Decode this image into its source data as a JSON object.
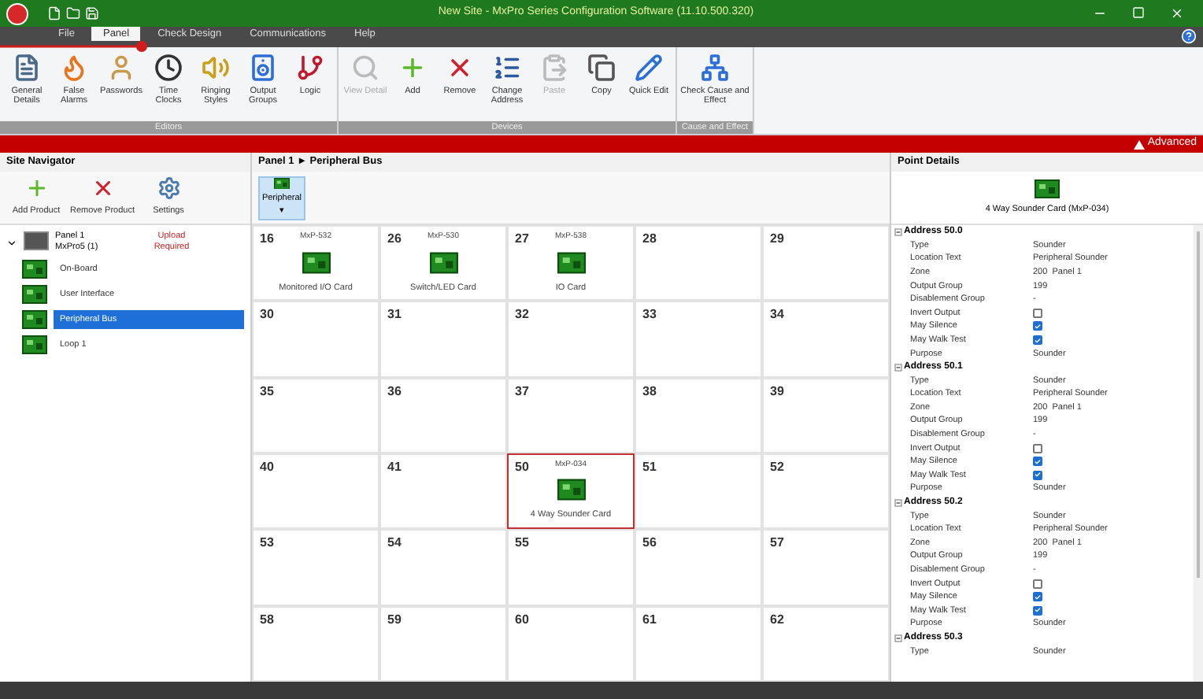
{
  "window": {
    "title": "New Site - MxPro Series Configuration Software (11.10.500.320)"
  },
  "menu_tabs": [
    {
      "label": "File",
      "selected": false
    },
    {
      "label": "Panel",
      "selected": true
    },
    {
      "label": "Check Design",
      "selected": false
    },
    {
      "label": "Communications",
      "selected": false
    },
    {
      "label": "Help",
      "selected": false
    }
  ],
  "ribbon_groups": [
    {
      "title": "Editors",
      "buttons": [
        {
          "label": "General Details",
          "kind": "details",
          "disabled": false
        },
        {
          "label": "False Alarms",
          "kind": "alarm",
          "disabled": false
        },
        {
          "label": "Passwords",
          "kind": "user",
          "disabled": false
        },
        {
          "label": "Time Clocks",
          "kind": "clock",
          "disabled": false
        },
        {
          "label": "Ringing Styles",
          "kind": "speaker",
          "disabled": false
        },
        {
          "label": "Output Groups",
          "kind": "groups",
          "disabled": false
        },
        {
          "label": "Logic",
          "kind": "logic",
          "disabled": false
        }
      ]
    },
    {
      "title": "Devices",
      "buttons": [
        {
          "label": "View Detail",
          "kind": "view",
          "disabled": true
        },
        {
          "label": "Add",
          "kind": "add",
          "disabled": false
        },
        {
          "label": "Remove",
          "kind": "remove",
          "disabled": false
        },
        {
          "label": "Change Address",
          "kind": "address",
          "disabled": false
        },
        {
          "label": "Paste",
          "kind": "paste",
          "disabled": true
        },
        {
          "label": "Copy",
          "kind": "copy",
          "disabled": false
        },
        {
          "label": "Quick Edit",
          "kind": "edit",
          "disabled": false
        }
      ]
    },
    {
      "title": "Cause and Effect",
      "buttons": [
        {
          "label": "Check Cause and Effect",
          "kind": "cause",
          "disabled": false
        }
      ]
    }
  ],
  "brand": "Advanced",
  "site_navigator": {
    "title": "Site Navigator",
    "tools": [
      {
        "label": "Add Product",
        "kind": "add"
      },
      {
        "label": "Remove Product",
        "kind": "remove"
      },
      {
        "label": "Settings",
        "kind": "settings"
      }
    ],
    "tree": [
      {
        "label": "Panel 1",
        "sublabel": "MxPro5 (1)",
        "status": "Upload Required",
        "expanded": true,
        "children": [
          {
            "label": "On-Board",
            "selected": false
          },
          {
            "label": "User Interface",
            "selected": false
          },
          {
            "label": "Peripheral Bus",
            "selected": true
          },
          {
            "label": "Loop 1",
            "selected": false
          }
        ]
      }
    ]
  },
  "peripheral_bus": {
    "breadcrumb": "Panel 1 ► Peripheral Bus",
    "tool": "Peripheral ▾",
    "cells": [
      {
        "address": "16",
        "model": "MxP-532",
        "name": "Monitored I/O Card",
        "selected": false
      },
      {
        "address": "26",
        "model": "MxP-530",
        "name": "Switch/LED Card",
        "selected": false
      },
      {
        "address": "27",
        "model": "MxP-538",
        "name": "IO Card",
        "selected": false
      },
      {
        "address": "28"
      },
      {
        "address": "29"
      },
      {
        "address": "30"
      },
      {
        "address": "31"
      },
      {
        "address": "32"
      },
      {
        "address": "33"
      },
      {
        "address": "34"
      },
      {
        "address": "35"
      },
      {
        "address": "36"
      },
      {
        "address": "37"
      },
      {
        "address": "38"
      },
      {
        "address": "39"
      },
      {
        "address": "40"
      },
      {
        "address": "41"
      },
      {
        "address": "50",
        "model": "MxP-034",
        "name": "4 Way Sounder Card",
        "selected": true
      },
      {
        "address": "51"
      },
      {
        "address": "52"
      },
      {
        "address": "53"
      },
      {
        "address": "54"
      },
      {
        "address": "55"
      },
      {
        "address": "56"
      },
      {
        "address": "57"
      },
      {
        "address": "58"
      },
      {
        "address": "59"
      },
      {
        "address": "60"
      },
      {
        "address": "61"
      },
      {
        "address": "62"
      }
    ]
  },
  "point_details": {
    "title": "Point Details",
    "device": "4 Way Sounder Card (MxP-034)",
    "groups": [
      {
        "title": "Address 50.0",
        "properties": [
          {
            "name": "Type",
            "value": "Sounder"
          },
          {
            "name": "Location Text",
            "value": "Peripheral Sounder"
          },
          {
            "name": "Zone",
            "value": "200  Panel 1"
          },
          {
            "name": "Output Group",
            "value": "199"
          },
          {
            "name": "Disablement Group",
            "value": "-"
          },
          {
            "name": "Invert Output",
            "kind": "check",
            "checked": false
          },
          {
            "name": "May Silence",
            "kind": "check",
            "checked": true
          },
          {
            "name": "May Walk Test",
            "kind": "check",
            "checked": true
          },
          {
            "name": "Purpose",
            "value": "Sounder"
          }
        ]
      },
      {
        "title": "Address 50.1",
        "properties": [
          {
            "name": "Type",
            "value": "Sounder"
          },
          {
            "name": "Location Text",
            "value": "Peripheral Sounder"
          },
          {
            "name": "Zone",
            "value": "200  Panel 1"
          },
          {
            "name": "Output Group",
            "value": "199"
          },
          {
            "name": "Disablement Group",
            "value": "-"
          },
          {
            "name": "Invert Output",
            "kind": "check",
            "checked": false
          },
          {
            "name": "May Silence",
            "kind": "check",
            "checked": true
          },
          {
            "name": "May Walk Test",
            "kind": "check",
            "checked": true
          },
          {
            "name": "Purpose",
            "value": "Sounder"
          }
        ]
      },
      {
        "title": "Address 50.2",
        "properties": [
          {
            "name": "Type",
            "value": "Sounder"
          },
          {
            "name": "Location Text",
            "value": "Peripheral Sounder"
          },
          {
            "name": "Zone",
            "value": "200  Panel 1"
          },
          {
            "name": "Output Group",
            "value": "199"
          },
          {
            "name": "Disablement Group",
            "value": "-"
          },
          {
            "name": "Invert Output",
            "kind": "check",
            "checked": false
          },
          {
            "name": "May Silence",
            "kind": "check",
            "checked": true
          },
          {
            "name": "May Walk Test",
            "kind": "check",
            "checked": true
          },
          {
            "name": "Purpose",
            "value": "Sounder"
          }
        ]
      },
      {
        "title": "Address 50.3",
        "properties": [
          {
            "name": "Type",
            "value": "Sounder"
          }
        ]
      }
    ]
  }
}
